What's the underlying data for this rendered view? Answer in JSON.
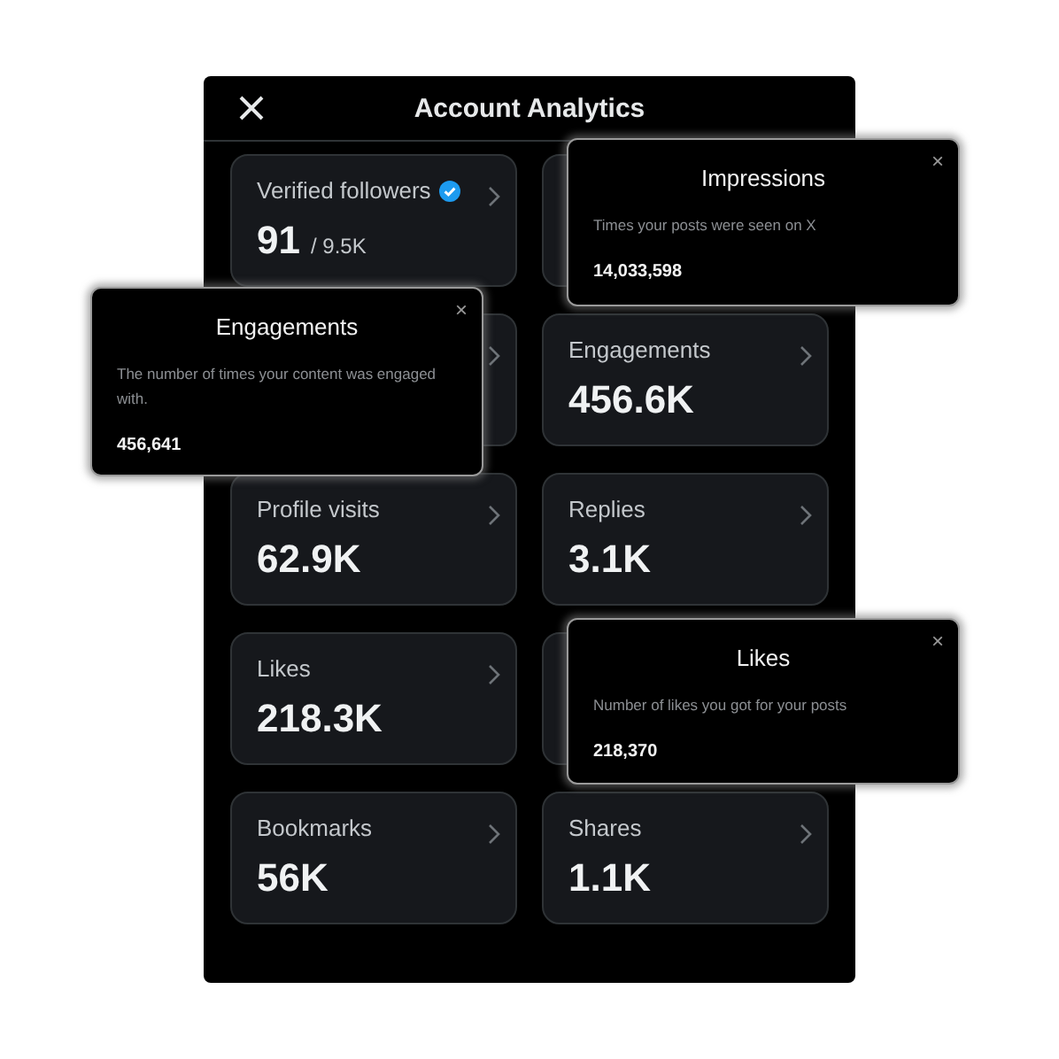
{
  "window": {
    "title": "Account Analytics"
  },
  "cards": [
    {
      "kind": "metric",
      "label": "Verified followers",
      "verified": true,
      "value": "91",
      "suffix": "/ 9.5K"
    },
    {
      "kind": "covered"
    },
    {
      "kind": "covered",
      "chevron": true
    },
    {
      "kind": "metric",
      "label": "Engagements",
      "value": "456.6K"
    },
    {
      "kind": "metric",
      "label": "Profile visits",
      "value": "62.9K"
    },
    {
      "kind": "metric",
      "label": "Replies",
      "value": "3.1K"
    },
    {
      "kind": "metric",
      "label": "Likes",
      "value": "218.3K"
    },
    {
      "kind": "covered"
    },
    {
      "kind": "metric",
      "label": "Bookmarks",
      "value": "56K"
    },
    {
      "kind": "metric",
      "label": "Shares",
      "value": "1.1K"
    }
  ],
  "tooltips": [
    {
      "title": "Impressions",
      "description": "Times your posts were seen on X",
      "value": "14,033,598",
      "close": "×"
    },
    {
      "title": "Engagements",
      "description": "The number of times your content was engaged with.",
      "value": "456,641",
      "close": "×"
    },
    {
      "title": "Likes",
      "description": "Number of likes you got for your posts",
      "value": "218,370",
      "close": "×"
    }
  ]
}
